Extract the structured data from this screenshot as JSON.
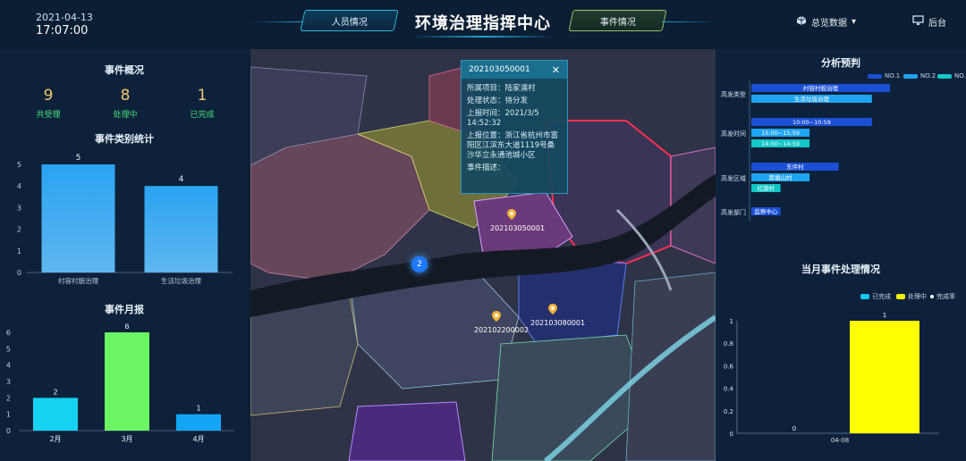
{
  "header": {
    "date": "2021-04-13",
    "time": "17:07:00",
    "title": "环境治理指挥中心",
    "tab_left": "人员情况",
    "tab_right": "事件情况",
    "data_menu": "总览数据",
    "backend": "后台"
  },
  "overview": {
    "title": "事件概况",
    "stats": [
      {
        "value": "9",
        "label": "共受理"
      },
      {
        "value": "8",
        "label": "处理中"
      },
      {
        "value": "1",
        "label": "已完成"
      }
    ]
  },
  "category_chart": {
    "title": "事件类别统计",
    "chart_data": {
      "type": "bar",
      "categories": [
        "村容村貌治理",
        "生活垃圾治理"
      ],
      "values": [
        5,
        4
      ],
      "ylim": [
        0,
        5
      ],
      "yticks": [
        0,
        1,
        2,
        3,
        4,
        5
      ],
      "color_top": "#2aa3f2",
      "color_bottom": "#5fb6ef"
    }
  },
  "monthly_chart": {
    "title": "事件月报",
    "chart_data": {
      "type": "bar",
      "categories": [
        "2月",
        "3月",
        "4月"
      ],
      "values": [
        2,
        6,
        1
      ],
      "colors": [
        "#14d2f0",
        "#6cf562",
        "#14a6f5"
      ],
      "ylim": [
        0,
        6
      ],
      "yticks": [
        0,
        1,
        2,
        3,
        4,
        5,
        6
      ]
    }
  },
  "popup": {
    "id": "202103050001",
    "project": "所属项目：陆家浦村",
    "status": "处理状态：待分发",
    "report_time_label": "上报时间：2021/3/5",
    "report_time_clock": "14:52:32",
    "location": "上报位置：浙江省杭州市富阳区江滨东大道1119号桑沙华立永通池城小区",
    "desc_label": "事件描述："
  },
  "map": {
    "markers": [
      "202103050001",
      "202103080001",
      "202102200002"
    ],
    "cluster_count": "2"
  },
  "analysis": {
    "title": "分析预判",
    "legend": [
      {
        "label": "NO.1",
        "color": "#1a4fd6"
      },
      {
        "label": "NO.2",
        "color": "#1ea4f0"
      },
      {
        "label": "NO.3",
        "color": "#12c7c7"
      }
    ],
    "rows": [
      {
        "label": "高发类型",
        "bars": [
          {
            "text": "村容村貌治理",
            "value": 1.0,
            "color": "#1a4fd6"
          },
          {
            "text": "生活垃圾治理",
            "value": 0.87,
            "color": "#1ea4f0"
          }
        ]
      },
      {
        "label": "高发时间",
        "bars": [
          {
            "text": "10:00~10:59",
            "value": 0.87,
            "color": "#1a4fd6"
          },
          {
            "text": "15:00~15:59",
            "value": 0.42,
            "color": "#1ea4f0"
          },
          {
            "text": "14:00~14:59",
            "value": 0.42,
            "color": "#12c7c7"
          }
        ]
      },
      {
        "label": "高发区域",
        "bars": [
          {
            "text": "东坪村",
            "value": 0.63,
            "color": "#1a4fd6"
          },
          {
            "text": "南塘山村",
            "value": 0.42,
            "color": "#1ea4f0"
          },
          {
            "text": "红旗村",
            "value": 0.21,
            "color": "#12c7c7"
          }
        ]
      },
      {
        "label": "高发部门",
        "bars": [
          {
            "text": "监察中心",
            "value": 0.21,
            "color": "#1a4fd6"
          }
        ]
      }
    ]
  },
  "month_processing": {
    "title": "当月事件处理情况",
    "legend": [
      {
        "label": "已完成",
        "color": "#14c8f0"
      },
      {
        "label": "处理中",
        "color": "#f5ec10"
      },
      {
        "label": "完成率",
        "color": "#ffffff"
      }
    ],
    "chart_data": {
      "type": "bar",
      "categories": [
        "04-08"
      ],
      "series": [
        {
          "name": "已完成",
          "values": [
            0
          ]
        },
        {
          "name": "处理中",
          "values": [
            1
          ]
        }
      ],
      "ylim": [
        0,
        1
      ],
      "yticks": [
        "0",
        "0.2",
        "0.4",
        "0.6",
        "0.8",
        "1"
      ]
    }
  }
}
